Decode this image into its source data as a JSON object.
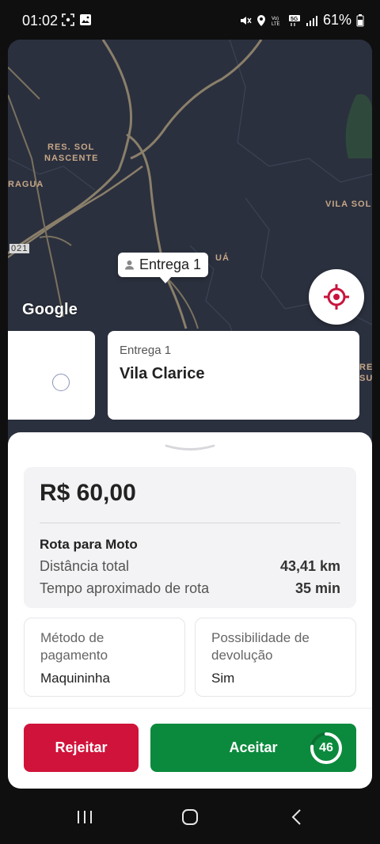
{
  "status_bar": {
    "time": "01:02",
    "battery": "61%",
    "network": "5G"
  },
  "map": {
    "labels": [
      "RES. SOL",
      "NASCENTE",
      "RAGUA",
      "VILA SOL",
      "021",
      "UÁ",
      "REF",
      "SUE"
    ],
    "pin_label": "Entrega 1",
    "attribution": "Google"
  },
  "delivery_card": {
    "title": "Entrega 1",
    "place": "Vila Clarice"
  },
  "summary": {
    "price": "R$ 60,00",
    "route_title": "Rota para Moto",
    "distance_label": "Distância total",
    "distance_value": "43,41 km",
    "time_label": "Tempo aproximado de rota",
    "time_value": "35 min"
  },
  "payment": {
    "label": "Método de pagamento",
    "value": "Maquininha"
  },
  "return_option": {
    "label": "Possibilidade de devolução",
    "value": "Sim"
  },
  "actions": {
    "reject_label": "Rejeitar",
    "accept_label": "Aceitar",
    "timer": "46",
    "timer_progress": 0.77
  },
  "colors": {
    "reject": "#d0133a",
    "accept": "#0b8a3d",
    "locate_icon": "#c8143c"
  }
}
